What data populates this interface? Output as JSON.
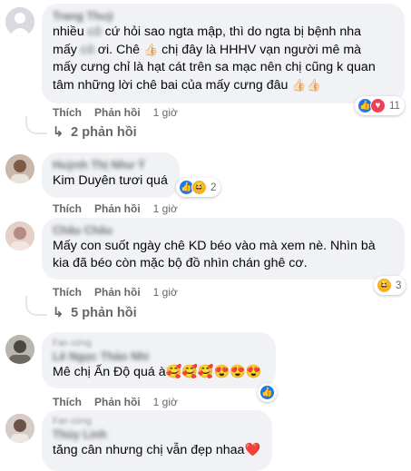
{
  "comments": [
    {
      "author": "Trang Thuỷ",
      "lines": [
        "nhiều",
        "cứ hỏi sao ngta mập, thì do ngta bị bệnh nha",
        "mấy",
        "ơi. Chê",
        "chị đây là HHHV vạn người mê mà",
        "mấy cưng chỉ là hạt cát trên sa mạc nên chị cũng k quan",
        "tâm những lời chê bai của mấy cưng đâu"
      ],
      "blur_word_1": "cô",
      "blur_word_2": "cô",
      "actions": {
        "like": "Thích",
        "reply": "Phản hồi",
        "time": "1 giờ"
      },
      "reaction_count": "11",
      "reactions": [
        "like-icon",
        "love-icon"
      ],
      "replies_label": "2 phản hồi"
    },
    {
      "author": "Huỳnh Thị Như Ý",
      "text": "Kim Duyên tươi quá",
      "actions": {
        "like": "Thích",
        "reply": "Phản hồi",
        "time": "1 giờ"
      },
      "reaction_count": "2",
      "reactions": [
        "like-icon",
        "haha-icon"
      ]
    },
    {
      "author": "Châu Châu",
      "lines": [
        "Mấy con suốt ngày chê KD béo vào mà xem nè. Nhìn bà",
        "kia đã béo còn mặc bộ đồ nhìn chán ghê cơ."
      ],
      "actions": {
        "like": "Thích",
        "reply": "Phản hồi",
        "time": "1 giờ"
      },
      "reaction_count": "3",
      "reactions": [
        "haha-icon"
      ],
      "replies_label": "5 phản hồi"
    },
    {
      "badge": "Fan cứng",
      "author": "Lê Ngọc Thảo Nhi",
      "text": "Mê chị Ấn Độ quá à🥰🥰🥰😍😍😍",
      "actions": {
        "like": "Thích",
        "reply": "Phản hồi",
        "time": "1 giờ"
      },
      "reactions": [
        "like-icon"
      ]
    },
    {
      "badge": "Fan cứng",
      "author": "Thùy Linh",
      "text": "tăng cân nhưng chị vẫn đẹp nhaa❤️"
    }
  ],
  "colors": {
    "bubble": "#f0f2f5",
    "meta": "#65676b",
    "like": "#1877f2",
    "love": "#f33e58",
    "haha": "#f7b125"
  }
}
